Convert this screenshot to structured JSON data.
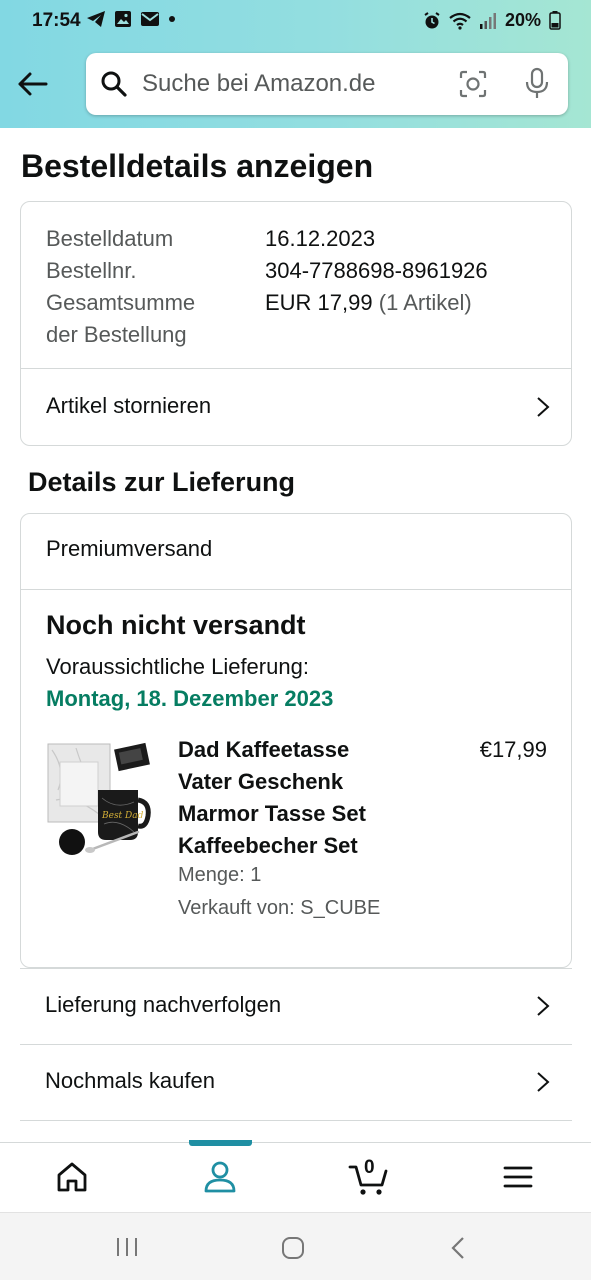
{
  "status_bar": {
    "time": "17:54",
    "battery": "20%"
  },
  "search": {
    "placeholder": "Suche bei Amazon.de"
  },
  "page": {
    "title": "Bestelldetails anzeigen"
  },
  "order": {
    "date_label": "Bestelldatum",
    "date_value": "16.12.2023",
    "number_label": "Bestellnr.",
    "number_value": "304-7788698-8961926",
    "total_label_line1": "Gesamtsumme",
    "total_label_line2": "der Bestellung",
    "total_value": "EUR 17,99",
    "total_items": "(1 Artikel)",
    "cancel_label": "Artikel stornieren"
  },
  "delivery": {
    "section_title": "Details zur Lieferung",
    "shipping_speed": "Premiumversand",
    "status": "Noch nicht versandt",
    "eta_label": "Voraussichtliche Lieferung:",
    "eta_date": "Montag, 18. Dezember 2023",
    "item": {
      "title_line1": "Dad Kaffeetasse",
      "title_line2": "Vater Geschenk",
      "title_line3": "Marmor Tasse Set",
      "title_line4": "Kaffeebecher Set",
      "price": "€17,99",
      "quantity": "Menge: 1",
      "seller": "Verkauft von: S_CUBE",
      "image_text": "Best Dad"
    }
  },
  "actions": {
    "track": "Lieferung nachverfolgen",
    "buy_again": "Nochmals kaufen"
  },
  "bottom_nav": {
    "cart_count": "0",
    "active_color": "#1f8fa3"
  },
  "colors": {
    "eta_green": "#067d62",
    "header_gradient_start": "#82d8e3",
    "header_gradient_end": "#a5e6d3"
  }
}
